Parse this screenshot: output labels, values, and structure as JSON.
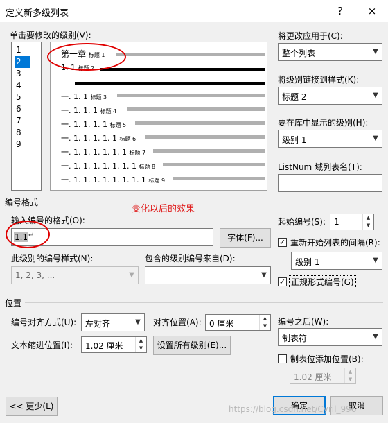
{
  "window": {
    "title": "定义新多级列表",
    "help": "?",
    "close": "×"
  },
  "level_select": {
    "label": "单击要修改的级别(V):",
    "levels": [
      "1",
      "2",
      "3",
      "4",
      "5",
      "6",
      "7",
      "8",
      "9"
    ],
    "selected": "2"
  },
  "preview": {
    "rows": [
      {
        "text": "第一章",
        "style": "标题 1"
      },
      {
        "text": "1. 1",
        "style": "标题 2"
      },
      {
        "text": "一. 1. 1",
        "style": "标题 3"
      },
      {
        "text": "一. 1. 1. 1",
        "style": "标题 4"
      },
      {
        "text": "一. 1. 1. 1. 1",
        "style": "标题 5"
      },
      {
        "text": "一. 1. 1. 1. 1. 1",
        "style": "标题 6"
      },
      {
        "text": "一. 1. 1. 1. 1. 1. 1",
        "style": "标题 7"
      },
      {
        "text": "一. 1. 1. 1. 1. 1. 1. 1",
        "style": "标题 8"
      },
      {
        "text": "一. 1. 1. 1. 1. 1. 1. 1. 1",
        "style": "标题 9"
      }
    ]
  },
  "apply_to": {
    "label": "将更改应用于(C):",
    "value": "整个列表"
  },
  "link_style": {
    "label": "将级别链接到样式(K):",
    "value": "标题 2"
  },
  "gallery_level": {
    "label": "要在库中显示的级别(H):",
    "value": "级别 1"
  },
  "listnum": {
    "label": "ListNum 域列表名(T):",
    "value": ""
  },
  "number_format": {
    "section": "编号格式",
    "annotation": "变化以后的效果",
    "input_label": "输入编号的格式(O):",
    "input_value": "1.1",
    "font_button": "字体(F)...",
    "style_label": "此级别的编号样式(N):",
    "style_value": "1, 2, 3, ...",
    "include_label": "包含的级别编号来自(D):",
    "include_value": "",
    "start_label": "起始编号(S):",
    "start_value": "1",
    "restart_label": "重新开始列表的间隔(R):",
    "restart_checked": true,
    "restart_value": "级别 1",
    "legal_label": "正规形式编号(G)",
    "legal_checked": true
  },
  "position": {
    "section": "位置",
    "align_label": "编号对齐方式(U):",
    "align_value": "左对齐",
    "align_at_label": "对齐位置(A):",
    "align_at_value": "0 厘米",
    "indent_label": "文本缩进位置(I):",
    "indent_value": "1.02 厘米",
    "set_all_button": "设置所有级别(E)...",
    "follow_label": "编号之后(W):",
    "follow_value": "制表符",
    "tab_label": "制表位添加位置(B):",
    "tab_checked": false,
    "tab_value": "1.02 厘米"
  },
  "footer": {
    "less": "<< 更少(L)",
    "ok": "确定",
    "cancel": "取消",
    "watermark": "https://blog.csdn.net/Cyril_996"
  }
}
